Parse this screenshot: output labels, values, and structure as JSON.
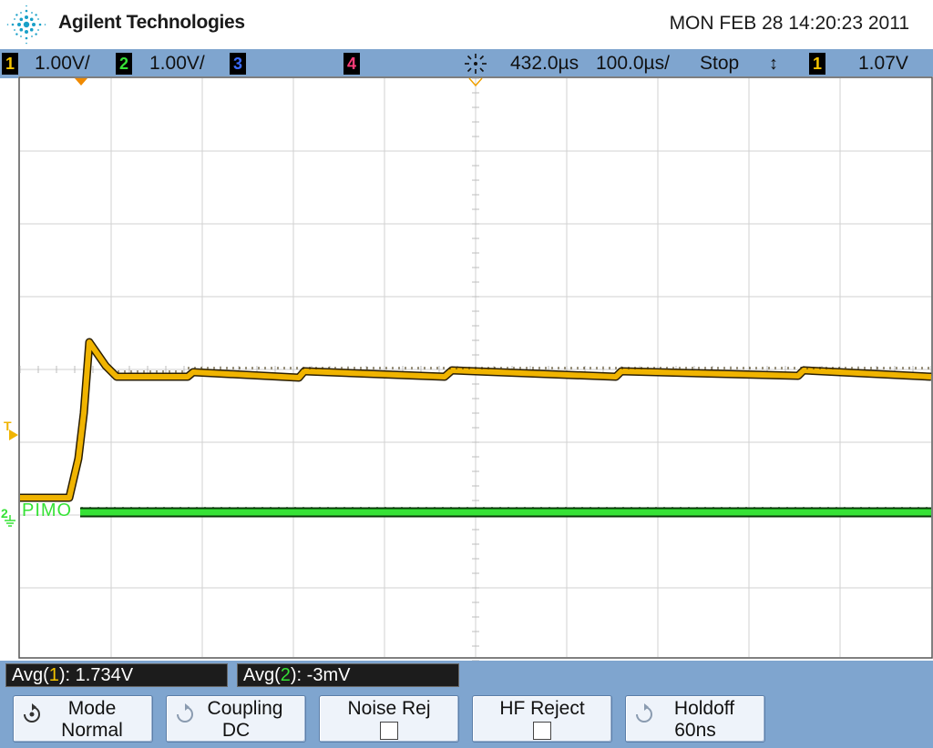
{
  "header": {
    "brand": "Agilent Technologies",
    "datetime": "MON FEB 28 14:20:23 2011"
  },
  "status": {
    "ch1": {
      "num": "1",
      "scale": "1.00V/",
      "color": "#f5c400"
    },
    "ch2": {
      "num": "2",
      "scale": "1.00V/",
      "color": "#36e236"
    },
    "ch3": {
      "num": "3",
      "color": "#3c6cff"
    },
    "ch4": {
      "num": "4",
      "color": "#ff3c78"
    },
    "time_delay": "432.0µs",
    "time_scale": "100.0µs/",
    "run_state": "Stop",
    "trigger_source": "1",
    "trigger_level": "1.07V"
  },
  "screen": {
    "channel2_label": "PIMO",
    "ch1_marker": "T",
    "ch2_marker": "2"
  },
  "measurements": {
    "m1": {
      "prefix": "Avg(",
      "channel": "1",
      "suffix": "): 1.734V"
    },
    "m2": {
      "prefix": "Avg(",
      "channel": "2",
      "suffix": "): -3mV"
    }
  },
  "softkeys": {
    "mode": {
      "title": "Mode",
      "value": "Normal"
    },
    "coupling": {
      "title": "Coupling",
      "value": "DC"
    },
    "noise_rej": {
      "title": "Noise Rej"
    },
    "hf_reject": {
      "title": "HF Reject"
    },
    "holdoff": {
      "title": "Holdoff",
      "value": "60ns"
    }
  },
  "colors": {
    "trace_ch1": "#f0b400",
    "trace_ch2": "#36e236",
    "bar_background": "#7fa5cf",
    "grid": "#d2d2d2"
  },
  "icons": {
    "logo": "agilent-spark-logo",
    "trigger": "trigger-position-icon",
    "updown": "up-down-arrow-icon",
    "softkey_rotate": "entry-knob-icon"
  }
}
